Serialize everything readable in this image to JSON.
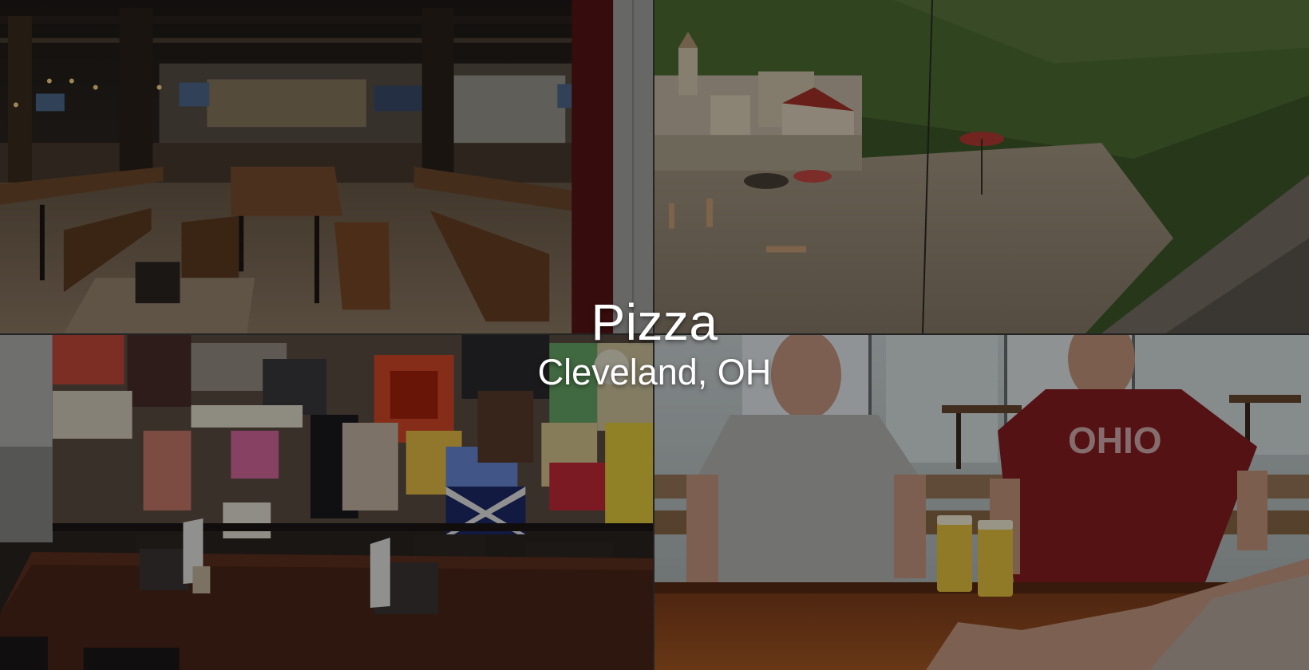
{
  "hero": {
    "title": "Pizza",
    "subtitle": "Cleveland, OH"
  },
  "photos": [
    {
      "subject": "brewery taproom with long wooden tables"
    },
    {
      "subject": "painted seaside village mural"
    },
    {
      "subject": "dining area with poster collage wall"
    },
    {
      "subject": "two men at bar counter with beers, one in OHIO t-shirt"
    }
  ],
  "shirt_text": "OHIO",
  "colors": {
    "overlay": "#000000",
    "text": "#ffffff",
    "divider": "#3a3a3a"
  }
}
